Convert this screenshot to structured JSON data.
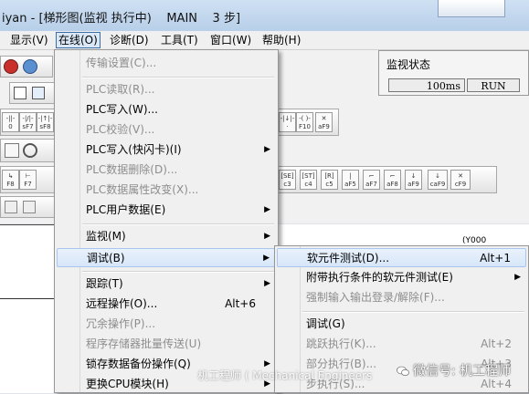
{
  "window": {
    "title": "iyan - [梯形图(监视 执行中)    MAIN    3 步]"
  },
  "menubar": {
    "items": [
      "显示(V)",
      "在线(O)",
      "诊断(D)",
      "工具(T)",
      "窗口(W)",
      "帮助(H)"
    ]
  },
  "monitor": {
    "title": "监视状态",
    "scan_time": "100ms",
    "status": "RUN"
  },
  "toolbar": {
    "row1_fkeys": [
      "F10",
      "aF9"
    ],
    "row2_fkeys": [
      "sF7",
      "sF8",
      "aF7",
      "aF8",
      "aF5",
      "caF5",
      "caF10"
    ],
    "row3_fkeys": [
      "F8",
      "F7",
      "c3",
      "c4",
      "c5",
      "aF5",
      "aF7",
      "aF8",
      "aF9",
      "caF9",
      "cF9"
    ]
  },
  "online_menu": {
    "items": [
      {
        "label": "传输设置(C)...",
        "disabled": true,
        "shortcut": "",
        "submenu": false
      },
      {
        "label": "PLC读取(R)...",
        "disabled": true,
        "shortcut": "",
        "submenu": false
      },
      {
        "label": "PLC写入(W)...",
        "disabled": false,
        "shortcut": "",
        "submenu": false
      },
      {
        "label": "PLC校验(V)...",
        "disabled": true,
        "shortcut": "",
        "submenu": false
      },
      {
        "label": "PLC写入(快闪卡)(I)",
        "disabled": false,
        "shortcut": "",
        "submenu": true
      },
      {
        "label": "PLC数据删除(D)...",
        "disabled": true,
        "shortcut": "",
        "submenu": false
      },
      {
        "label": "PLC数据属性改变(X)...",
        "disabled": true,
        "shortcut": "",
        "submenu": false
      },
      {
        "label": "PLC用户数据(E)",
        "disabled": false,
        "shortcut": "",
        "submenu": true
      },
      {
        "label": "监视(M)",
        "disabled": false,
        "shortcut": "",
        "submenu": true
      },
      {
        "label": "调试(B)",
        "disabled": false,
        "shortcut": "",
        "submenu": true
      },
      {
        "label": "跟踪(T)",
        "disabled": false,
        "shortcut": "",
        "submenu": true
      },
      {
        "label": "远程操作(O)...",
        "disabled": false,
        "shortcut": "Alt+6",
        "submenu": false
      },
      {
        "label": "冗余操作(P)...",
        "disabled": true,
        "shortcut": "",
        "submenu": false
      },
      {
        "label": "程序存储器批量传送(U)",
        "disabled": true,
        "shortcut": "",
        "submenu": false
      },
      {
        "label": "锁存数据备份操作(Q)",
        "disabled": false,
        "shortcut": "",
        "submenu": true
      },
      {
        "label": "更换CPU模块(H)",
        "disabled": false,
        "shortcut": "",
        "submenu": true
      }
    ]
  },
  "debug_submenu": {
    "items": [
      {
        "label": "软元件测试(D)...",
        "disabled": false,
        "shortcut": "Alt+1",
        "submenu": false
      },
      {
        "label": "附带执行条件的软元件测试(E)",
        "disabled": false,
        "shortcut": "",
        "submenu": true
      },
      {
        "label": "强制输入输出登录/解除(F)...",
        "disabled": true,
        "shortcut": "",
        "submenu": false
      },
      {
        "label": "调试(G)",
        "disabled": false,
        "shortcut": "",
        "submenu": false
      },
      {
        "label": "跳跃执行(K)...",
        "disabled": true,
        "shortcut": "Alt+2",
        "submenu": false
      },
      {
        "label": "部分执行(B)...",
        "disabled": true,
        "shortcut": "Alt+3",
        "submenu": false
      },
      {
        "label": "步执行(S)...",
        "disabled": true,
        "shortcut": "Alt+4",
        "submenu": false
      }
    ]
  },
  "ladder": {
    "corner_text": "(Y000"
  },
  "watermark": {
    "left": "机工程师 ( Mechanical Engineers",
    "right": "微信号: 机工程师"
  }
}
